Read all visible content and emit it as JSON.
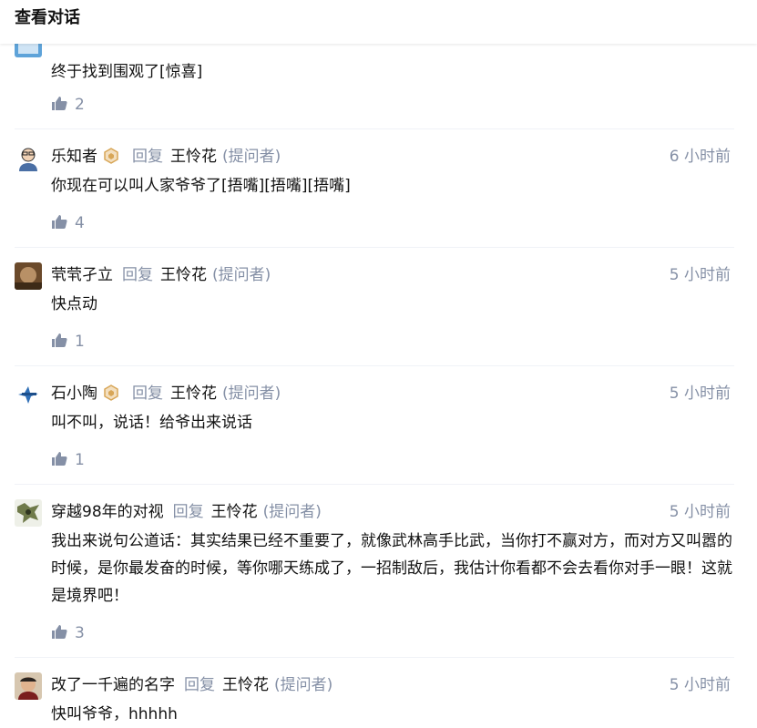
{
  "header": {
    "title": "查看对话"
  },
  "comments": [
    {
      "author": "",
      "content": "终于找到围观了[惊喜]",
      "likes": "2"
    },
    {
      "author": "乐知者",
      "reply_label": "回复",
      "reply_to": "王怜花",
      "role": "(提问者)",
      "time": "6 小时前",
      "content": "你现在可以叫人家爷爷了[捂嘴][捂嘴][捂嘴]",
      "likes": "4"
    },
    {
      "author": "茕茕孑立",
      "reply_label": "回复",
      "reply_to": "王怜花",
      "role": "(提问者)",
      "time": "5 小时前",
      "content": "快点动",
      "likes": "1"
    },
    {
      "author": "石小陶",
      "reply_label": "回复",
      "reply_to": "王怜花",
      "role": "(提问者)",
      "time": "5 小时前",
      "content": "叫不叫，说话！给爷出来说话",
      "likes": "1"
    },
    {
      "author": "穿越98年的对视",
      "reply_label": "回复",
      "reply_to": "王怜花",
      "role": "(提问者)",
      "time": "5 小时前",
      "content": "我出来说句公道话：其实结果已经不重要了，就像武林高手比武，当你打不赢对方，而对方又叫嚣的时候，是你最发奋的时候，等你哪天练成了，一招制敌后，我估计你看都不会去看你对手一眼！这就是境界吧！",
      "likes": "3"
    },
    {
      "author": "改了一千遍的名字",
      "reply_label": "回复",
      "reply_to": "王怜花",
      "role": "(提问者)",
      "time": "5 小时前",
      "content": "快叫爷爷，hhhhh"
    }
  ],
  "icons": {
    "like": "thumbs-up-icon",
    "badge": "hexagon-badge-icon"
  },
  "colors": {
    "secondary_text": "#8590a6",
    "primary_text": "#121212",
    "badge": "#d8a657",
    "divider": "#f0f2f7"
  }
}
